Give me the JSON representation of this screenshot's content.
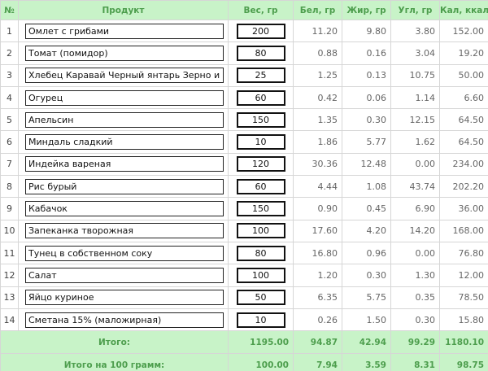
{
  "header": {
    "num": "№",
    "product": "Продукт",
    "weight": "Вес, гр",
    "protein": "Бел, гр",
    "fat": "Жир, гр",
    "carbs": "Угл, гр",
    "kcal": "Кал, ккал"
  },
  "rows": [
    {
      "num": "1",
      "name": "Омлет с грибами",
      "weight": "200",
      "protein": "11.20",
      "fat": "9.80",
      "carbs": "3.80",
      "kcal": "152.00"
    },
    {
      "num": "2",
      "name": "Томат (помидор)",
      "weight": "80",
      "protein": "0.88",
      "fat": "0.16",
      "carbs": "3.04",
      "kcal": "19.20"
    },
    {
      "num": "3",
      "name": "Хлебец Каравай Черный янтарь Зерно и сол",
      "weight": "25",
      "protein": "1.25",
      "fat": "0.13",
      "carbs": "10.75",
      "kcal": "50.00"
    },
    {
      "num": "4",
      "name": "Огурец",
      "weight": "60",
      "protein": "0.42",
      "fat": "0.06",
      "carbs": "1.14",
      "kcal": "6.60"
    },
    {
      "num": "5",
      "name": "Апельсин",
      "weight": "150",
      "protein": "1.35",
      "fat": "0.30",
      "carbs": "12.15",
      "kcal": "64.50"
    },
    {
      "num": "6",
      "name": "Миндаль сладкий",
      "weight": "10",
      "protein": "1.86",
      "fat": "5.77",
      "carbs": "1.62",
      "kcal": "64.50"
    },
    {
      "num": "7",
      "name": "Индейка вареная",
      "weight": "120",
      "protein": "30.36",
      "fat": "12.48",
      "carbs": "0.00",
      "kcal": "234.00"
    },
    {
      "num": "8",
      "name": "Рис бурый",
      "weight": "60",
      "protein": "4.44",
      "fat": "1.08",
      "carbs": "43.74",
      "kcal": "202.20"
    },
    {
      "num": "9",
      "name": "Кабачок",
      "weight": "150",
      "protein": "0.90",
      "fat": "0.45",
      "carbs": "6.90",
      "kcal": "36.00"
    },
    {
      "num": "10",
      "name": "Запеканка творожная",
      "weight": "100",
      "protein": "17.60",
      "fat": "4.20",
      "carbs": "14.20",
      "kcal": "168.00"
    },
    {
      "num": "11",
      "name": "Тунец в собственном соку",
      "weight": "80",
      "protein": "16.80",
      "fat": "0.96",
      "carbs": "0.00",
      "kcal": "76.80"
    },
    {
      "num": "12",
      "name": "Салат",
      "weight": "100",
      "protein": "1.20",
      "fat": "0.30",
      "carbs": "1.30",
      "kcal": "12.00"
    },
    {
      "num": "13",
      "name": "Яйцо куриное",
      "weight": "50",
      "protein": "6.35",
      "fat": "5.75",
      "carbs": "0.35",
      "kcal": "78.50"
    },
    {
      "num": "14",
      "name": "Сметана 15% (маложирная)",
      "weight": "10",
      "protein": "0.26",
      "fat": "1.50",
      "carbs": "0.30",
      "kcal": "15.80"
    }
  ],
  "totals": {
    "label": "Итого:",
    "weight": "1195.00",
    "protein": "94.87",
    "fat": "42.94",
    "carbs": "99.29",
    "kcal": "1180.10"
  },
  "per100": {
    "label": "Итого на 100 грамм:",
    "weight": "100.00",
    "protein": "7.94",
    "fat": "3.59",
    "carbs": "8.31",
    "kcal": "98.75"
  },
  "colors": {
    "header_bg": "#c8f3c8",
    "header_text": "#4d9e4d",
    "border": "#d6d6d6"
  }
}
